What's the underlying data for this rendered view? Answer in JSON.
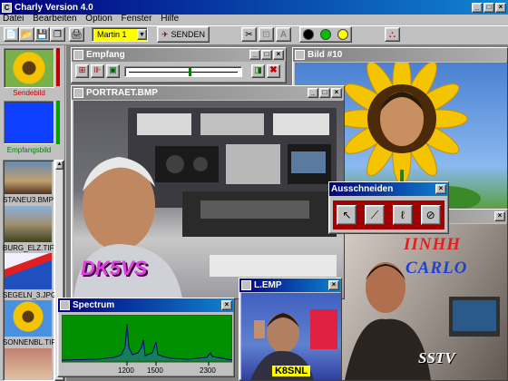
{
  "app": {
    "title": "Charly Version 4.0"
  },
  "menu": [
    "Datei",
    "Bearbeiten",
    "Option",
    "Fenster",
    "Hilfe"
  ],
  "toolbar": {
    "callsign_value": "Martin 1",
    "send_label": "SENDEN",
    "status_colors": [
      "#000000",
      "#00c000",
      "#ffff00",
      "#ffff00"
    ]
  },
  "sidebar": {
    "send_label": "Sendebild",
    "receive_label": "Empfangsbild",
    "thumbs": [
      "STANEU3.BMP",
      "BURG_ELZ.TIF",
      "SEGELN_3.JPG",
      "SONNENBL.TIF"
    ]
  },
  "windows": {
    "empfang": "Empfang",
    "bild10": "Bild #10",
    "portrait": "PORTRAET.BMP",
    "ausschneiden": "Ausschneiden",
    "spectrum": "Spectrum",
    "lemp": "L.EMP",
    "ninhh": ""
  },
  "images": {
    "portrait_text": "DK5VS",
    "carlo_line1": "IINHH",
    "carlo_line2": "CARLO",
    "carlo_line3": "SSTV",
    "kssnl": "K8SNL"
  },
  "spectrum": {
    "tick_labels": [
      "1200",
      "1500",
      "2300"
    ]
  }
}
